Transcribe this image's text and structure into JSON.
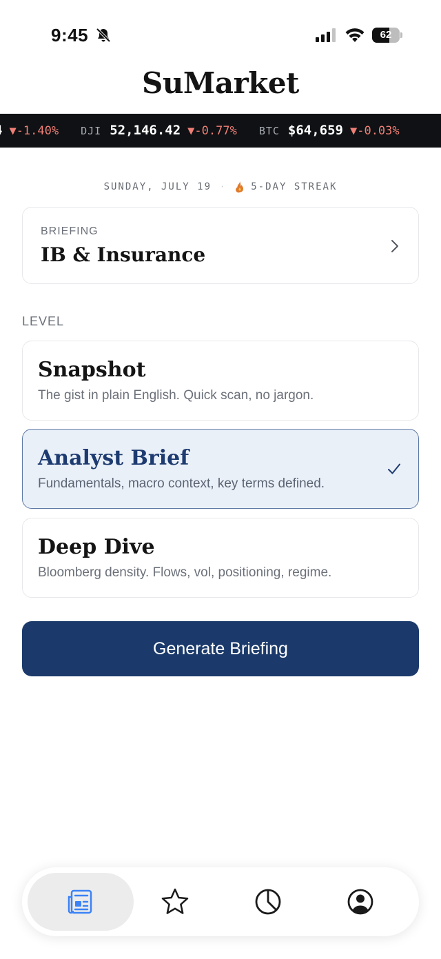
{
  "status_bar": {
    "time": "9:45",
    "battery_level": "62",
    "battery_fraction": 0.62
  },
  "app": {
    "title": "SuMarket"
  },
  "ticker": {
    "items": [
      {
        "symbol": "",
        "price": "4",
        "change": "▼-1.40%"
      },
      {
        "symbol": "DJI",
        "price": "52,146.42",
        "change": "▼-0.77%"
      },
      {
        "symbol": "BTC",
        "price": "$64,659",
        "change": "▼-0.03%"
      }
    ]
  },
  "date_line": {
    "date": "SUNDAY, JULY 19",
    "separator": "·",
    "streak": "5-DAY STREAK"
  },
  "briefing": {
    "label": "BRIEFING",
    "value": "IB & Insurance"
  },
  "level": {
    "label": "LEVEL",
    "options": [
      {
        "title": "Snapshot",
        "description": "The gist in plain English. Quick scan, no jargon.",
        "selected": false
      },
      {
        "title": "Analyst Brief",
        "description": "Fundamentals, macro context, key terms defined.",
        "selected": true
      },
      {
        "title": "Deep Dive",
        "description": "Bloomberg density. Flows, vol, positioning, regime.",
        "selected": false
      }
    ]
  },
  "actions": {
    "generate_label": "Generate Briefing"
  },
  "bottom_nav": {
    "items": [
      {
        "icon": "newspaper-icon",
        "active": true
      },
      {
        "icon": "star-icon",
        "active": false
      },
      {
        "icon": "pie-chart-icon",
        "active": false
      },
      {
        "icon": "profile-icon",
        "active": false
      }
    ]
  },
  "colors": {
    "primary": "#1b3a6b",
    "selected_bg": "#eaf0f8",
    "ticker_bg": "#0f1114",
    "ticker_down": "#ef7f76",
    "active_nav_icon": "#3b82f6"
  }
}
